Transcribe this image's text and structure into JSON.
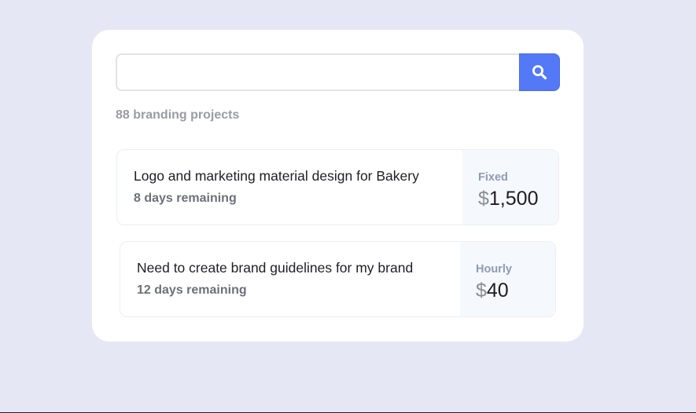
{
  "search": {
    "value": "",
    "placeholder": ""
  },
  "results": {
    "count_label": "88 branding projects"
  },
  "projects": [
    {
      "title": "Logo and marketing material design for Bakery",
      "remaining": "8 days remaining",
      "price_type": "Fixed",
      "currency": "$",
      "amount": "1,500"
    },
    {
      "title": "Need to create brand guidelines for my brand",
      "remaining": "12 days remaining",
      "price_type": "Hourly",
      "currency": "$",
      "amount": "40"
    }
  ],
  "icons": {
    "search_button": "search-icon"
  },
  "colors": {
    "background": "#e5e8f4",
    "accent": "#5479f7",
    "price_panel": "#f5f8fc"
  }
}
